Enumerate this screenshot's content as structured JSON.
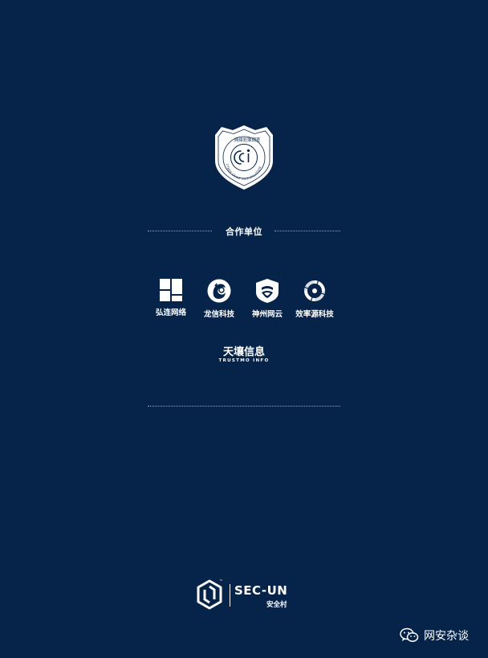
{
  "badge": {
    "arc_cn": "网络犯罪调查",
    "arc_en": "CYBER CRIME INVESTIGATION",
    "monogram": "CCI"
  },
  "partners": {
    "title": "合作单位",
    "items": [
      {
        "label": "弘连网络",
        "icon": "hong-lian-logo-icon"
      },
      {
        "label": "龙信科技",
        "icon": "long-xin-logo-icon"
      },
      {
        "label": "神州网云",
        "icon": "shen-zhou-logo-icon"
      },
      {
        "label": "效率源科技",
        "icon": "xiao-lv-yuan-logo-icon"
      }
    ],
    "tianrang": {
      "cn": "天壤信息",
      "en": "TRUSTMO INFO"
    }
  },
  "footer": {
    "brand_name": "SEC-UN",
    "brand_sub": "安全村",
    "trademark": "™"
  },
  "watermark": {
    "text": "网安杂谈",
    "icon": "wechat-icon"
  },
  "colors": {
    "background": "#06244a",
    "foreground": "#ffffff",
    "dotted_rule": "#8ea3c0"
  }
}
